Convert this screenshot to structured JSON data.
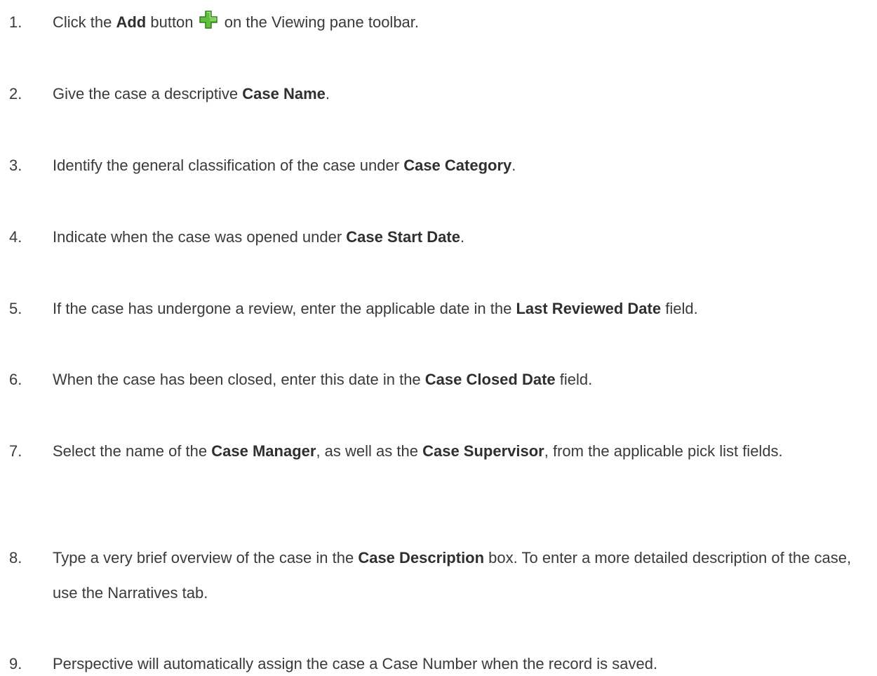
{
  "steps": [
    {
      "number": "1.",
      "parts": [
        "Click the ",
        "Add",
        " button ",
        " on the Viewing pane toolbar."
      ]
    },
    {
      "number": "2.",
      "parts": [
        "Give the case a descriptive ",
        "Case Name",
        "."
      ]
    },
    {
      "number": "3.",
      "parts": [
        "Identify the general classification of the case under ",
        "Case Category",
        "."
      ]
    },
    {
      "number": "4.",
      "parts": [
        "Indicate when the case was opened under ",
        "Case Start Date",
        "."
      ]
    },
    {
      "number": "5.",
      "parts": [
        "If the case has undergone a review, enter the applicable date in the ",
        "Last Reviewed Date",
        " field."
      ]
    },
    {
      "number": "6.",
      "parts": [
        "When the case has been closed, enter this date in the ",
        "Case Closed Date",
        " field."
      ]
    },
    {
      "number": "7.",
      "parts": [
        "Select the name of the ",
        "Case Manager",
        ", as well as the ",
        "Case Supervisor",
        ", from the applicable pick list fields."
      ]
    },
    {
      "number": "8.",
      "parts": [
        "Type a very brief overview of the case in the ",
        "Case Description",
        " box. To enter a more detailed description of the case, use the Narratives tab."
      ]
    },
    {
      "number": "9.",
      "parts": [
        "Perspective will automatically assign the case a Case Number when the record is saved."
      ]
    }
  ],
  "icons": {
    "add": "plus-icon",
    "add_color": "#4caf2e"
  }
}
